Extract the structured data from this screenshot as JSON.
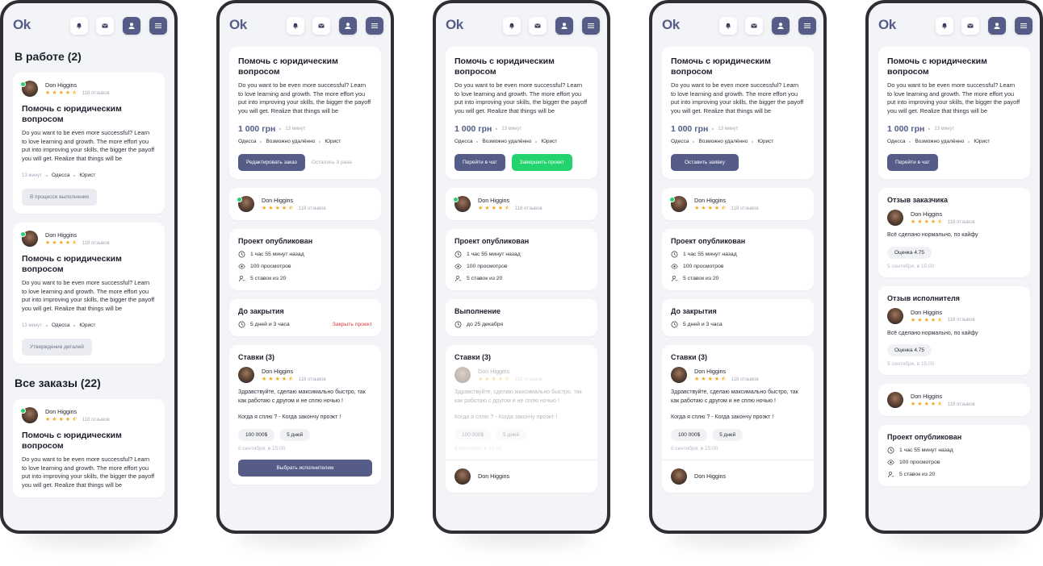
{
  "app": {
    "logo": "Ok",
    "icons": [
      "bell-icon",
      "mail-icon",
      "user-icon",
      "menu-icon"
    ]
  },
  "user": {
    "name": "Don Higgins",
    "reviews": "118 отзывов",
    "rating_stars": 4.5
  },
  "order": {
    "title": "Помочь с юридическим вопросом",
    "description": "Do you want to be even more successful? Learn to love learning and growth. The more effort you put into improving your skills, the bigger the payoff you will get. Realize that things will be",
    "price": "1 000 грн",
    "time": "13 минут",
    "city": "Одесса",
    "remote": "Возможно удалённо",
    "category": "Юрист"
  },
  "screen1": {
    "in_work_title": "В работе (2)",
    "all_orders_title": "Все заказы (22)",
    "status1": "В процессе выполнения",
    "status2": "Утверждение деталей"
  },
  "buttons": {
    "edit_order": "Редактировать заказ",
    "remaining": "Осталось 3 раза",
    "go_to_chat": "Перейти в чат",
    "finish_project": "Завершить проект",
    "leave_request": "Оставить заявку",
    "choose_executor": "Выбрать исполнителем",
    "close_project": "Закрыть проект"
  },
  "published": {
    "title": "Проект опубликован",
    "ago": "1 час 55 минут назад",
    "views": "100 просмотров",
    "bids": "5 ставок из 20"
  },
  "closing": {
    "title": "До закрытия",
    "time_left": "5 дней и 3 часа"
  },
  "execution": {
    "title": "Выполнение",
    "until": "до 25 декабря"
  },
  "bids": {
    "title": "Ставки (3)",
    "text1": "Здравствуйте, сделаю максимально быстро, так как работаю с другом и не сплю ночью !",
    "text2": "Когда я сплю ? - Когда закончу проэкт !",
    "amount": "100 000$",
    "days": "5 дней",
    "date": "5 сентября, в 15:00"
  },
  "reviews": {
    "customer_title": "Отзыв заказчика",
    "executor_title": "Отзыв исполнителя",
    "text": "Всё сделано нормально, по кайфу",
    "score": "Оценка 4.75",
    "date": "5 сентября, в 15:00"
  }
}
